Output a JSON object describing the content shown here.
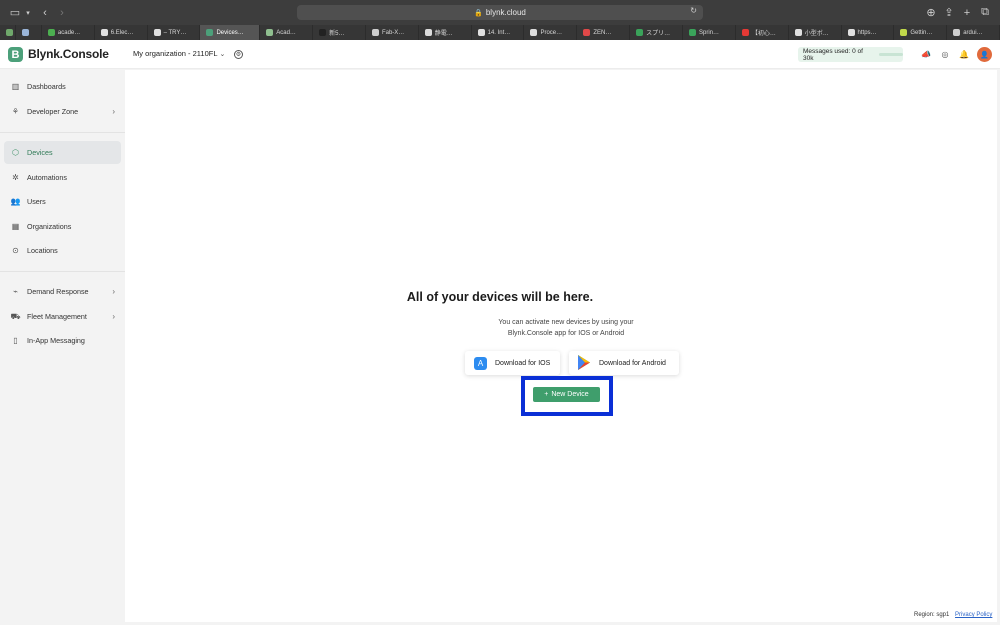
{
  "browser": {
    "url": "blynk.cloud",
    "tabs": [
      {
        "label": "",
        "icon": "grid-icon",
        "color": "#6fa86b"
      },
      {
        "label": "",
        "icon": "sheet-icon",
        "color": "#9ab5d8"
      },
      {
        "label": "acade…",
        "icon": "sheet-icon",
        "color": "#4caf50"
      },
      {
        "label": "6.Elec…",
        "icon": "github-icon",
        "color": "#e0e0e0"
      },
      {
        "label": "– TRY…",
        "icon": "github-icon",
        "color": "#e0e0e0"
      },
      {
        "label": "Devices…",
        "icon": "blynk-icon",
        "color": "#4ca07a"
      },
      {
        "label": "Acad…",
        "icon": "sheet-icon",
        "color": "#8fbf8f"
      },
      {
        "label": "新5…",
        "icon": "n-icon",
        "color": "#222"
      },
      {
        "label": "Fab-X…",
        "icon": "doc-icon",
        "color": "#cfcfcf"
      },
      {
        "label": "静電…",
        "icon": "circle-icon",
        "color": "#dcdcdc"
      },
      {
        "label": "14. Int…",
        "icon": "github-icon",
        "color": "#e0e0e0"
      },
      {
        "label": "Proce…",
        "icon": "circle-icon",
        "color": "#dcdcdc"
      },
      {
        "label": "ZEN…",
        "icon": "zen-icon",
        "color": "#e04848"
      },
      {
        "label": "スプリ…",
        "icon": "sheet-icon",
        "color": "#3aa35a"
      },
      {
        "label": "Sprin…",
        "icon": "sheet-icon",
        "color": "#3aa35a"
      },
      {
        "label": "【初心…",
        "icon": "youtube-icon",
        "color": "#e53935"
      },
      {
        "label": "小型ボ…",
        "icon": "page-icon",
        "color": "#e0e0e0"
      },
      {
        "label": "https…",
        "icon": "page-icon",
        "color": "#e0e0e0"
      },
      {
        "label": "Gettin…",
        "icon": "s-icon",
        "color": "#c0d84a"
      },
      {
        "label": "ardui…",
        "icon": "page-icon",
        "color": "#cfcfcf"
      }
    ]
  },
  "app": {
    "logo_letter": "B",
    "logo_text": "Blynk.Console",
    "organization": "My organization - 2110FL",
    "messages_used": "Messages used: 0 of 30k",
    "avatar_letter": "👤"
  },
  "sidebar": {
    "items": [
      {
        "label": "Dashboards",
        "icon": "chart-icon"
      },
      {
        "label": "Developer Zone",
        "icon": "dev-icon"
      },
      {
        "label": "Devices",
        "icon": "cube-icon"
      },
      {
        "label": "Automations",
        "icon": "automation-icon"
      },
      {
        "label": "Users",
        "icon": "users-icon"
      },
      {
        "label": "Organizations",
        "icon": "building-icon"
      },
      {
        "label": "Locations",
        "icon": "pin-icon"
      },
      {
        "label": "Demand Response",
        "icon": "demand-icon"
      },
      {
        "label": "Fleet Management",
        "icon": "truck-icon"
      },
      {
        "label": "In-App Messaging",
        "icon": "message-icon"
      }
    ]
  },
  "main": {
    "title": "All of your devices will be here.",
    "subtitle": "You can activate new devices by using your Blynk.Console app for IOS or Android",
    "download_ios": "Download for IOS",
    "download_android": "Download for Android",
    "new_device": "New Device"
  },
  "footer": {
    "region": "Region: sgp1",
    "privacy": "Privacy Policy"
  },
  "colors": {
    "accent": "#3f9e6c",
    "highlight": "#0a2fd6"
  }
}
